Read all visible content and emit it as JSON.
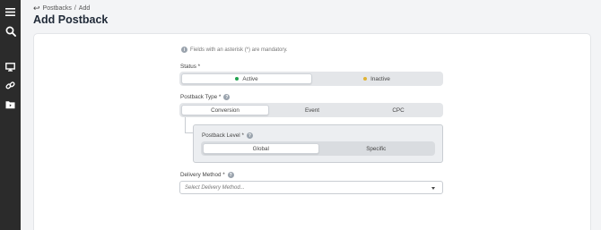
{
  "breadcrumb": {
    "parent": "Postbacks",
    "separator": "/",
    "current": "Add"
  },
  "page_title": "Add Postback",
  "note": "Fields with an asterisk (*) are mandatory.",
  "status": {
    "label": "Status *",
    "options": [
      {
        "label": "Active",
        "dot_color": "#22a350",
        "active": true
      },
      {
        "label": "Inactive",
        "dot_color": "#e0b233",
        "active": false
      }
    ]
  },
  "postback_type": {
    "label": "Postback Type *",
    "options": [
      {
        "label": "Conversion",
        "active": true
      },
      {
        "label": "Event",
        "active": false
      },
      {
        "label": "CPC",
        "active": false
      }
    ]
  },
  "postback_level": {
    "label": "Postback Level *",
    "options": [
      {
        "label": "Global",
        "active": true
      },
      {
        "label": "Specific",
        "active": false
      }
    ]
  },
  "delivery_method": {
    "label": "Delivery Method *",
    "placeholder": "Select Delivery Method..."
  },
  "sidebar": {
    "icons": [
      "menu-icon",
      "search-icon",
      "monitor-icon",
      "link-icon",
      "folder-icon"
    ]
  },
  "colors": {
    "sidebar_bg": "#2b2b2b",
    "page_bg": "#f3f4f6"
  }
}
